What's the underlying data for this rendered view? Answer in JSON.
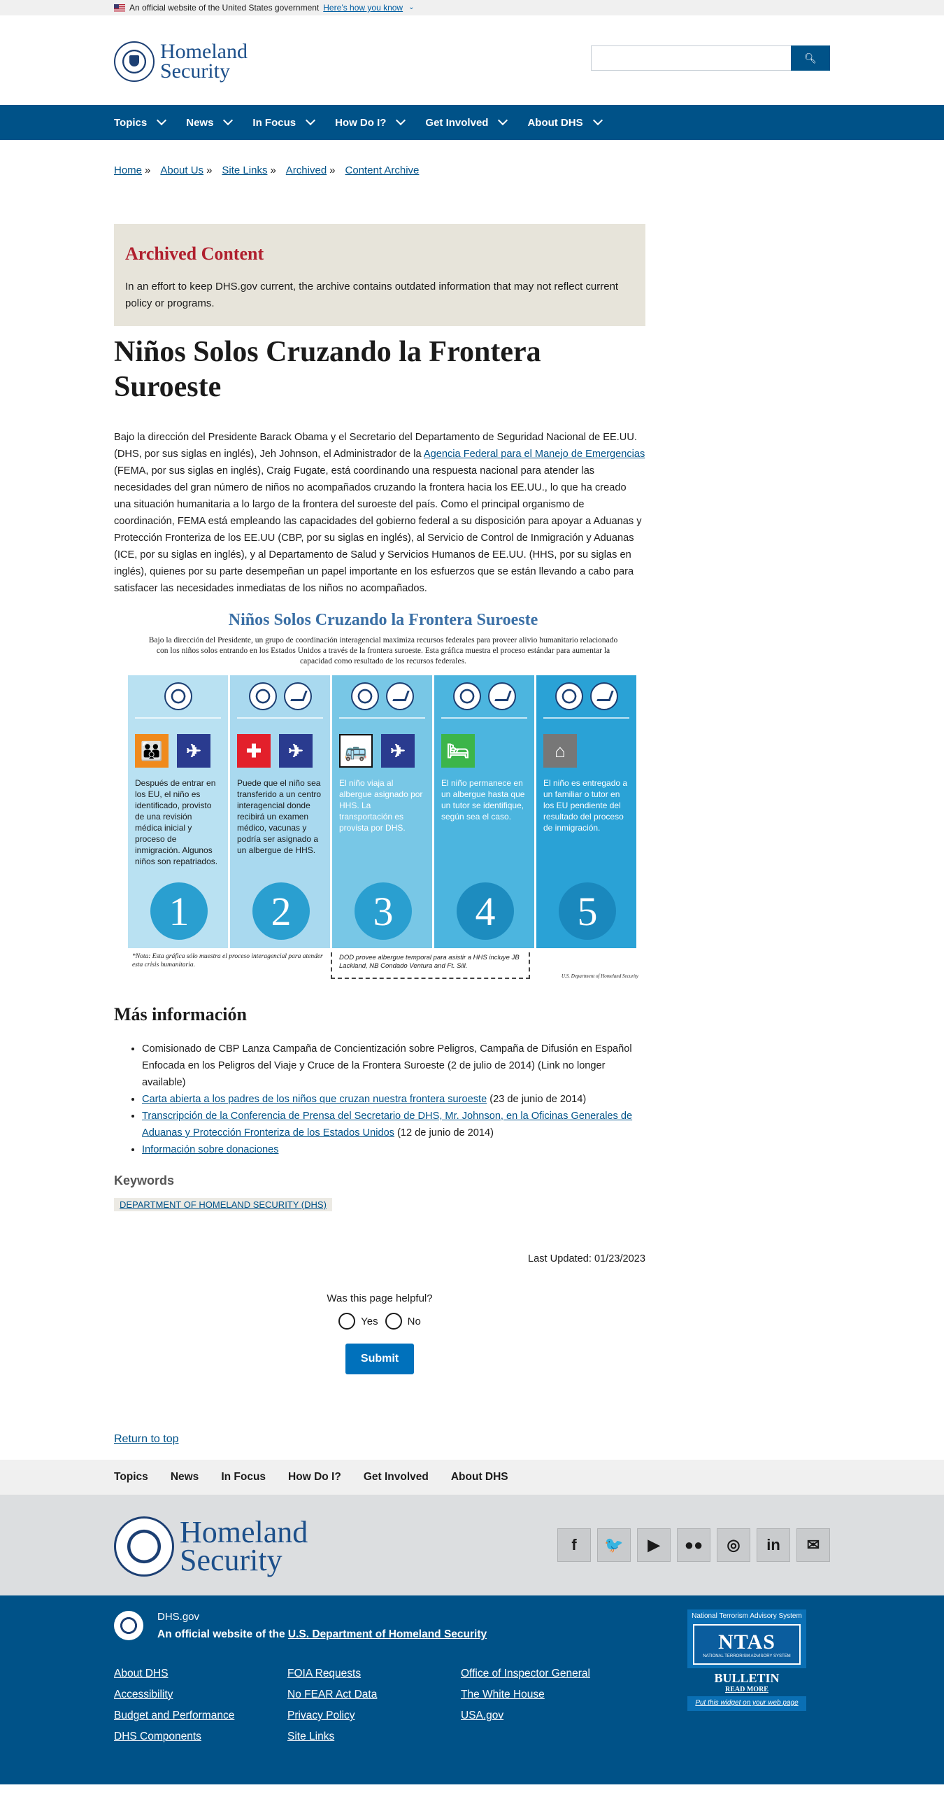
{
  "gov_banner": {
    "text": "An official website of the United States government",
    "link": "Here’s how you know"
  },
  "header": {
    "logo_line1": "Homeland",
    "logo_line2": "Security",
    "search_placeholder": "",
    "search_icon": "search-icon"
  },
  "nav": {
    "items": [
      {
        "label": "Topics"
      },
      {
        "label": "News"
      },
      {
        "label": "In Focus"
      },
      {
        "label": "How Do I?"
      },
      {
        "label": "Get Involved"
      },
      {
        "label": "About DHS"
      }
    ]
  },
  "breadcrumb": [
    "Home",
    "About Us",
    "Site Links",
    "Archived",
    "Content Archive"
  ],
  "archived": {
    "heading": "Archived Content",
    "text": "In an effort to keep DHS.gov current, the archive contains outdated information that may not reflect current policy or programs."
  },
  "page": {
    "title": "Niños Solos Cruzando la Frontera Suroeste",
    "body_before_link": "Bajo la dirección del Presidente Barack Obama y el Secretario del Departamento de Seguridad Nacional de EE.UU. (DHS, por sus siglas en inglés), Jeh Johnson, el Administrador de la ",
    "body_link": "Agencia Federal para el Manejo de Emergencias",
    "body_after_link": " (FEMA, por sus siglas en inglés), Craig Fugate, está coordinando una respuesta nacional para atender las necesidades del gran número de niños no acompañados cruzando la frontera hacia los EE.UU., lo que ha creado una situación humanitaria a lo largo de la frontera del suroeste del país. Como el principal organismo de coordinación, FEMA está empleando las capacidades del gobierno federal a su disposición para apoyar a Aduanas y Protección Fronteriza de los EE.UU (CBP, por su siglas en inglés), al Servicio de Control de Inmigración y Aduanas (ICE, por su siglas en inglés), y al Departamento de Salud y Servicios Humanos de EE.UU. (HHS, por su siglas en inglés), quienes por su parte desempeñan un papel importante en los esfuerzos que se están llevando a cabo para satisfacer las necesidades inmediatas de los niños no acompañados."
  },
  "infographic": {
    "title": "Niños Solos Cruzando la Frontera Suroeste",
    "subtitle": "Bajo la dirección del Presidente, un grupo de coordinación interagencial maximiza recursos federales para proveer alivio humanitario relacionado con los niños solos entrando en los Estados Unidos a través de la frontera suroeste. Esta gráfica muestra el proceso estándar para aumentar la capacidad como resultado de los recursos federales.",
    "steps": [
      {
        "number": "1",
        "text": "Después de entrar en los EU, el niño es identificado, provisto de una revisión médica inicial y proceso de inmigración.  Algunos niños son repatriados.",
        "bg": "#b9e1f2",
        "num_bg": "#2a9fd0",
        "icons": [
          "family-icon",
          "airplane-icon"
        ]
      },
      {
        "number": "2",
        "text": "Puede que el niño sea transferido a un centro interagencial donde recibirá un examen médico, vacunas y podría ser asignado a un albergue de HHS.",
        "bg": "#a9d9ef",
        "num_bg": "#2a9fd0",
        "icons": [
          "medical-cross-icon",
          "airplane-icon"
        ]
      },
      {
        "number": "3",
        "text": "El niño viaja al albergue asignado por HHS. La transportación es provista por DHS.",
        "bg": "#78c7e6",
        "num_bg": "#2a9fd0",
        "icons": [
          "bus-icon",
          "airplane-icon"
        ]
      },
      {
        "number": "4",
        "text": "El niño permanece en un albergue hasta que un tutor se identifique, según sea el caso.",
        "bg": "#4cb5df",
        "num_bg": "#1d8cbf",
        "icons": [
          "bed-icon"
        ]
      },
      {
        "number": "5",
        "text": "El niño es entregado a un familiar o tutor en los EU pendiente del resultado del proceso de inmigración.",
        "bg": "#2aa2d6",
        "num_bg": "#1a88bd",
        "icons": [
          "house-icon"
        ]
      }
    ],
    "note": "*Nota: Esta gráfica sólo muestra el proceso interagencial para atender esta crisis humanitaria.",
    "dod_note": "DOD provee albergue temporal para asistir a HHS incluye JB Lackland, NB Condado Ventura and Ft. Sill.",
    "credit": "U.S. Department of Homeland Security"
  },
  "more_info": {
    "heading": "Más información",
    "items": [
      {
        "text": "Comisionado de CBP Lanza Campaña de Concientización sobre Peligros, Campaña de Difusión en Español Enfocada en los Peligros del Viaje y Cruce de la Frontera Suroeste (2 de julio de 2014) (Link no longer available)",
        "link": "",
        "suffix": ""
      },
      {
        "text": "",
        "link": "Carta abierta a los padres de los niños que cruzan nuestra frontera suroeste",
        "suffix": " (23 de junio de 2014)"
      },
      {
        "text": "",
        "link": "Transcripción de la Conferencia de Prensa del Secretario de DHS, Mr. Johnson, en la Oficinas Generales de Aduanas y Protección Fronteriza de los Estados Unidos",
        "suffix": " (12 de junio de 2014)"
      },
      {
        "text": "",
        "link": "Información sobre donaciones",
        "suffix": ""
      }
    ]
  },
  "keywords": {
    "heading": "Keywords",
    "tag": "DEPARTMENT OF HOMELAND SECURITY (DHS)"
  },
  "last_updated": "Last Updated: 01/23/2023",
  "feedback": {
    "question": "Was this page helpful?",
    "yes": "Yes",
    "no": "No",
    "submit": "Submit"
  },
  "return_to_top": "Return to top",
  "footer_nav": [
    "Topics",
    "News",
    "In Focus",
    "How Do I?",
    "Get Involved",
    "About DHS"
  ],
  "footer_logo": {
    "line1": "Homeland",
    "line2": "Security"
  },
  "social": [
    {
      "icon": "facebook-icon",
      "glyph": "f"
    },
    {
      "icon": "twitter-icon",
      "glyph": "🐦"
    },
    {
      "icon": "youtube-icon",
      "glyph": "▶"
    },
    {
      "icon": "flickr-icon",
      "glyph": "●●"
    },
    {
      "icon": "instagram-icon",
      "glyph": "◎"
    },
    {
      "icon": "linkedin-icon",
      "glyph": "in"
    },
    {
      "icon": "email-icon",
      "glyph": "✉"
    }
  ],
  "footer": {
    "dhs_gov": "DHS.gov",
    "official_prefix": "An official website of the ",
    "official_link": "U.S. Department of Homeland Security",
    "columns": [
      [
        "About DHS",
        "Accessibility",
        "Budget and Performance",
        "DHS Components"
      ],
      [
        "FOIA Requests",
        "No FEAR Act Data",
        "Privacy Policy",
        "Site Links"
      ],
      [
        "Office of Inspector General",
        "The White House",
        "USA.gov"
      ]
    ],
    "ntas": {
      "title": "National Terrorism Advisory System",
      "big": "NTAS",
      "small": "NATIONAL TERRORISM ADVISORY SYSTEM",
      "bulletin": "BULLETIN",
      "read_more": "READ MORE",
      "put_widget": "Put this widget on your web page"
    }
  }
}
